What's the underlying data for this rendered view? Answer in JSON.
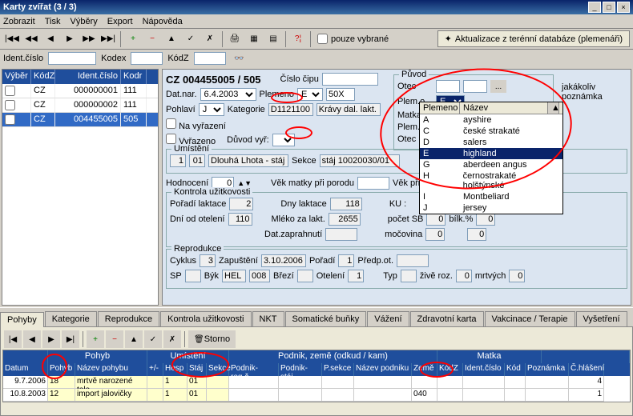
{
  "window": {
    "title": "Karty zvířat (3 / 3)"
  },
  "menu": {
    "zobrazit": "Zobrazit",
    "tisk": "Tisk",
    "vybery": "Výběry",
    "export": "Export",
    "napoveda": "Nápověda"
  },
  "toolbar": {
    "pouze_vybrane": "pouze vybrané",
    "aktualizace": "Aktualizace z terénní databáze (plemenáři)"
  },
  "filter": {
    "ident": "Ident.číslo",
    "kodex": "Kodex",
    "kodz": "KódZ"
  },
  "leftgrid": {
    "hdr": {
      "vyber": "Výběr",
      "kodz": "KódZ",
      "ident": "Ident.číslo",
      "kodr": "Kodr"
    },
    "rows": [
      {
        "kodz": "CZ",
        "ident": "000000001",
        "kodr": "111"
      },
      {
        "kodz": "CZ",
        "ident": "000000002",
        "kodr": "111"
      },
      {
        "kodz": "CZ",
        "ident": "004455005",
        "kodr": "505"
      }
    ]
  },
  "main": {
    "cz_ident": "CZ  004455005 / 505",
    "cislo_cipu_lbl": "Číslo čipu",
    "datnar_lbl": "Dat.nar.",
    "datnar": "6.4.2003",
    "plemeno_lbl": "Plemeno",
    "plemeno_code": "E",
    "plemeno_pct": "50X",
    "pohlavi_lbl": "Pohlaví",
    "pohlavi": "J",
    "kategorie_lbl": "Kategorie",
    "kategorie_code": "D1121100",
    "kategorie_name": "Krávy dal. lakt.",
    "na_vyrazeni": "Na vyřazení",
    "vyrazeno": "Vyřazeno",
    "duvod_lbl": "Důvod vyř:",
    "umisteni_lbl": "Umístění",
    "um1": "1",
    "um2": "01",
    "um3": "Dlouhá Lhota - stáj",
    "sekce_lbl": "Sekce",
    "sekce_val": "stáj 10020030/01",
    "hodnoceni_lbl": "Hodnocení",
    "hodnoceni": "0",
    "vek_matky_lbl": "Věk matky při porodu",
    "vek_pri_lbl": "Věk při 1.tel",
    "ku_lbl": "Kontrola užitkovosti",
    "poradi_lbl": "Pořadí laktace",
    "poradi": "2",
    "dny_lbl": "Dny laktace",
    "dny": "118",
    "dni_ot_lbl": "Dní od otelení",
    "dni_ot": "110",
    "mleko_lbl": "Mléko za lakt.",
    "mleko": "2655",
    "dat_zap_lbl": "Dat.zaprahnutí",
    "ku_field": "KU :",
    "pocet_sb_lbl": "počet SB",
    "pocet_sb": "0",
    "bilk_lbl": "bílk.%",
    "bilk": "0",
    "mocovina_lbl": "močovina",
    "mocovina": "0",
    "tuk_lbl": "",
    "tuk": "0",
    "repro_lbl": "Reprodukce",
    "cyklus_lbl": "Cyklus",
    "cyklus": "3",
    "zapusteni_lbl": "Zapuštění",
    "zapusteni": "3.10.2006",
    "poradi2_lbl": "Pořadí",
    "poradi2": "1",
    "predpot_lbl": "Předp.ot.",
    "sp_lbl": "SP",
    "byk_lbl": "Býk",
    "byk1": "HEL",
    "byk2": "008",
    "brezi_lbl": "Březí",
    "oteleni_lbl": "Otelení",
    "oteleni": "1",
    "typ_lbl": "Typ",
    "zive_lbl": "živě roz.",
    "zive": "0",
    "mrtv_lbl": "mrtvých",
    "mrtv": "0",
    "puvod_lbl": "Původ",
    "otec_lbl": "Otec",
    "plemo_lbl": "Plem.o.",
    "plemo_val": "E",
    "matka_lbl": "Matka",
    "plemm_lbl": "Plem.m.",
    "otecm_lbl": "Otec m.",
    "poznamka": "jakákoliv poznámka"
  },
  "dropdown": {
    "h1": "Plemeno",
    "h2": "Název",
    "rows": [
      {
        "c": "A",
        "n": "ayshire"
      },
      {
        "c": "C",
        "n": "české strakaté"
      },
      {
        "c": "D",
        "n": "salers"
      },
      {
        "c": "E",
        "n": "highland"
      },
      {
        "c": "G",
        "n": "aberdeen angus"
      },
      {
        "c": "H",
        "n": "černostrakaté holštýnské"
      },
      {
        "c": "I",
        "n": "Montbeliard"
      },
      {
        "c": "J",
        "n": "jersey"
      }
    ]
  },
  "tabs": {
    "pohyby": "Pohyby",
    "kategorie": "Kategorie",
    "reprodukce": "Reprodukce",
    "kontrola": "Kontrola užitkovosti",
    "nkt": "NKT",
    "somat": "Somatické buňky",
    "vazeni": "Vážení",
    "zdrav": "Zdravotní karta",
    "vakc": "Vakcinace / Terapie",
    "vyset": "Vyšetření"
  },
  "bottom": {
    "storno": "Storno",
    "grphdr": {
      "pohyb": "Pohyb",
      "umisteni": "Umístění",
      "podnik": "Podnik, země (odkud / kam)",
      "matka": "Matka"
    },
    "cols": {
      "datum": "Datum",
      "pohyb": "Pohyb",
      "nazev": "Název pohybu",
      "pm": "+/-",
      "hosp": "Hosp",
      "staj": "Stáj",
      "sekce": "Sekce",
      "podnikr": "Podnik-reg.č.",
      "podniks": "Podnik-stáj",
      "psekce": "P.sekce",
      "nazevp": "Název podniku",
      "zeme": "Země",
      "kodz": "KódZ",
      "ident": "Ident.číslo",
      "kod": "Kód",
      "pozn": "Poznámka",
      "chl": "Č.hlášení"
    },
    "rows": [
      {
        "datum": "9.7.2006",
        "pohyb": "18",
        "nazev": "mrtvě narozené tele",
        "pm": "",
        "hosp": "1",
        "staj": "01",
        "sekce": "",
        "zeme": "",
        "kodz": "",
        "ident": "",
        "chl": "4"
      },
      {
        "datum": "10.8.2003",
        "pohyb": "12",
        "nazev": "import jalovičky",
        "pm": "",
        "hosp": "1",
        "staj": "01",
        "sekce": "",
        "zeme": "040",
        "kodz": "",
        "ident": "",
        "chl": "1"
      }
    ]
  },
  "chart_data": null
}
